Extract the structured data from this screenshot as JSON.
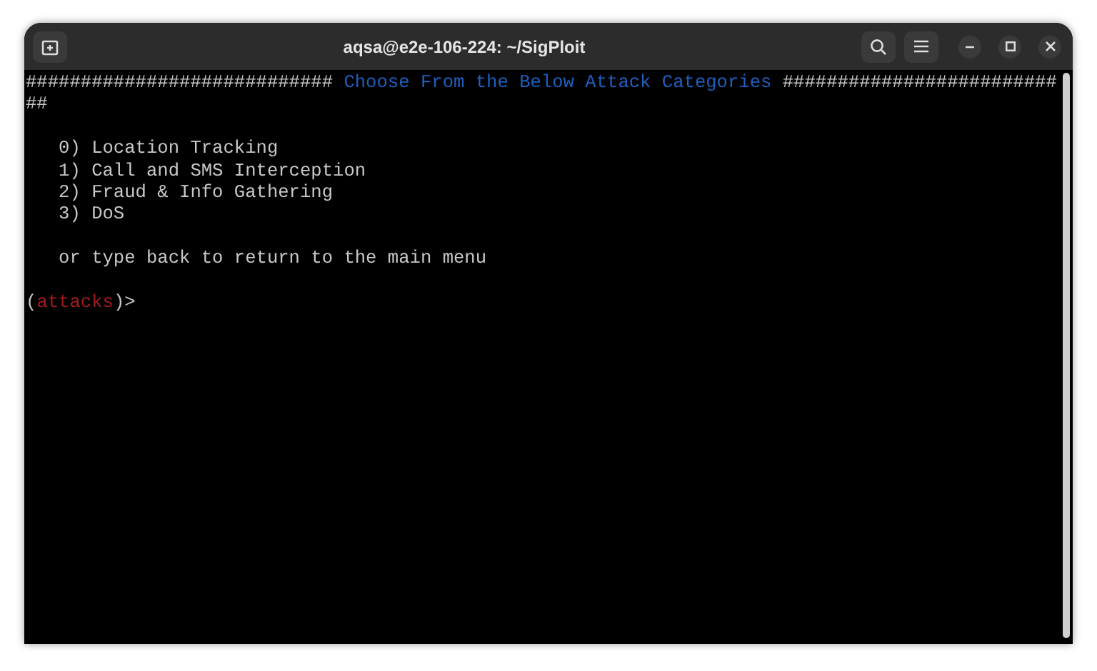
{
  "window": {
    "title": "aqsa@e2e-106-224: ~/SigPloit"
  },
  "terminal": {
    "lines": [
      {
        "kind": "banner",
        "left": "############################",
        "title": "Choose From the Below Attack Categories",
        "right": "###########################"
      },
      {
        "kind": "blank"
      },
      {
        "kind": "text",
        "text": "   0) Location Tracking"
      },
      {
        "kind": "text",
        "text": "   1) Call and SMS Interception"
      },
      {
        "kind": "text",
        "text": "   2) Fraud & Info Gathering"
      },
      {
        "kind": "text",
        "text": "   3) DoS"
      },
      {
        "kind": "blank"
      },
      {
        "kind": "text",
        "text": "   or type back to return to the main menu"
      },
      {
        "kind": "blank"
      },
      {
        "kind": "prompt",
        "open": "(",
        "name": "attacks",
        "close": ")>"
      }
    ]
  }
}
